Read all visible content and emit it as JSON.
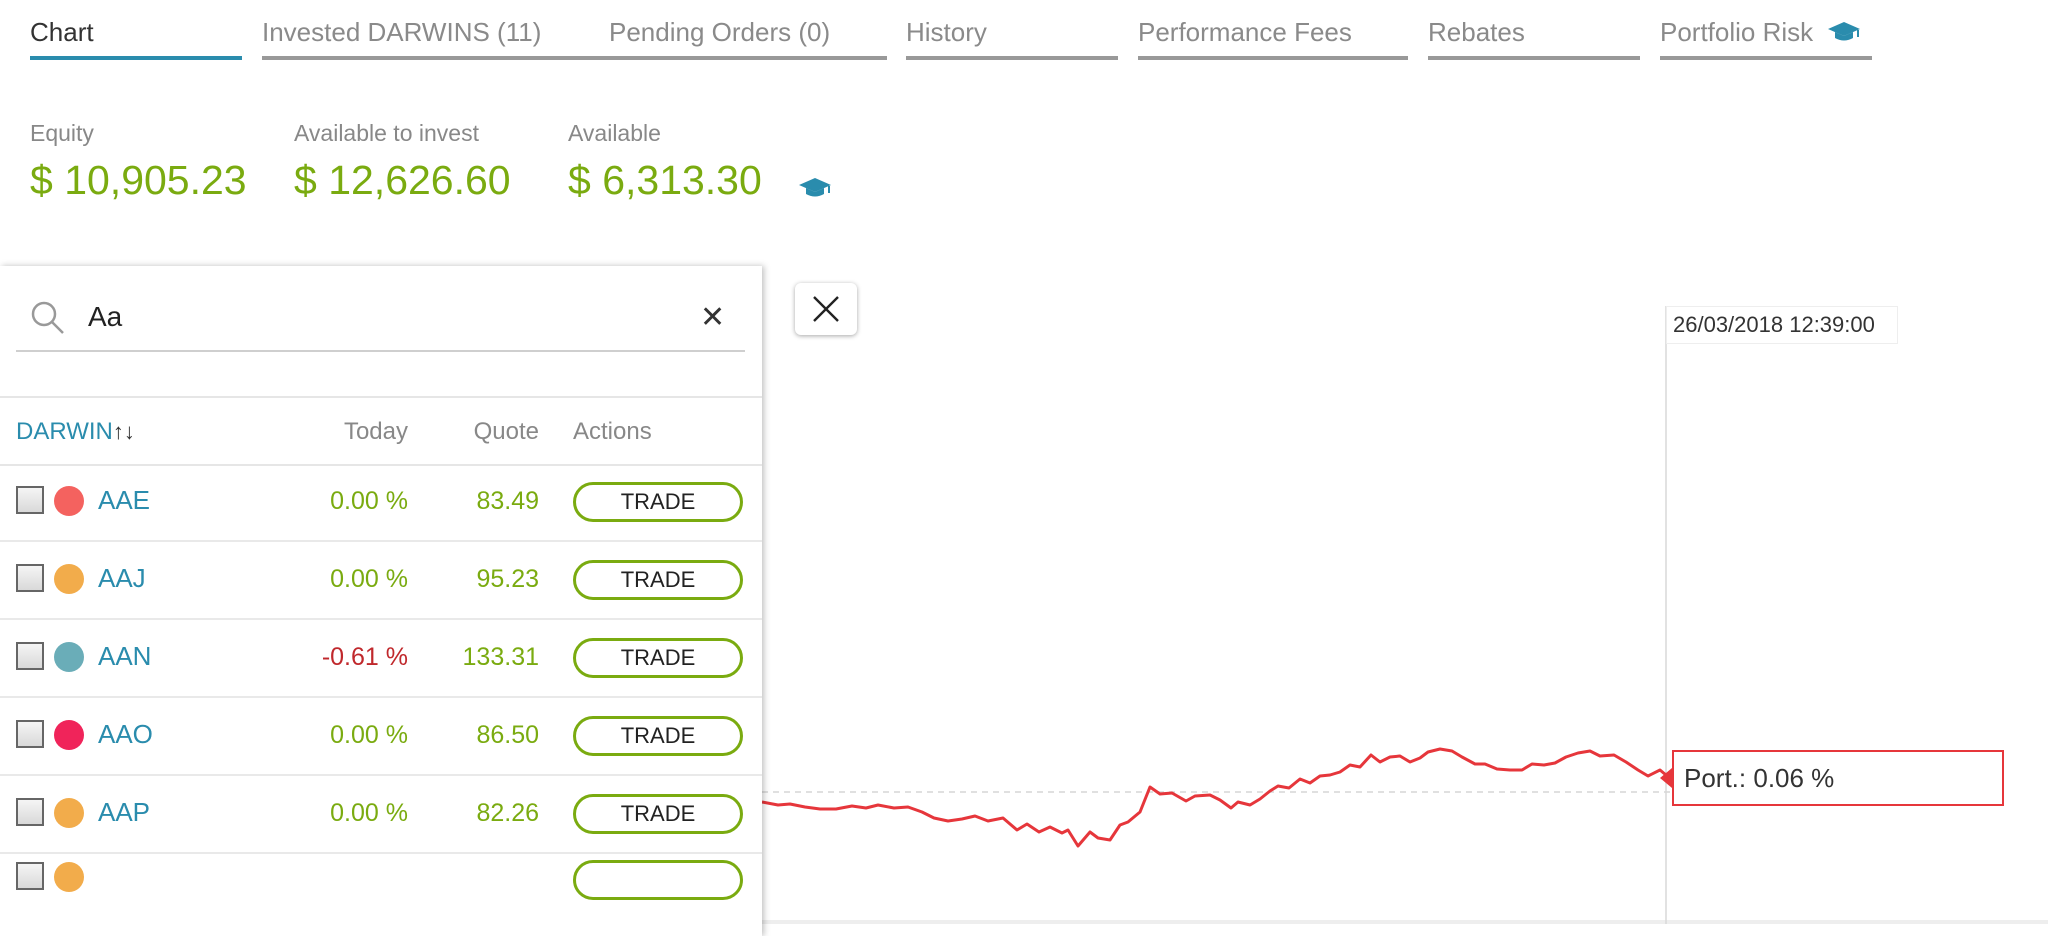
{
  "tabs": [
    {
      "label": "Chart"
    },
    {
      "label": "Invested DARWINS (11)"
    },
    {
      "label": "Pending Orders (0)"
    },
    {
      "label": "History"
    },
    {
      "label": "Performance Fees"
    },
    {
      "label": "Rebates"
    },
    {
      "label": "Portfolio Risk",
      "icon": "graduation-cap-icon"
    }
  ],
  "balances": {
    "equity": {
      "label": "Equity",
      "value": "$ 10,905.23"
    },
    "available_to_invest": {
      "label": "Available to invest",
      "value": "$ 12,626.60"
    },
    "available": {
      "label": "Available",
      "value": "$ 6,313.30"
    }
  },
  "search": {
    "value": "Aa",
    "clear_label": "✕"
  },
  "table": {
    "headers": {
      "darwin": "DARWIN",
      "sort_icon": "↑↓",
      "today": "Today",
      "quote": "Quote",
      "actions": "Actions"
    },
    "rows": [
      {
        "name": "AAE",
        "today": "0.00 %",
        "quote": "83.49",
        "action": "TRADE",
        "color": "#f4625f"
      },
      {
        "name": "AAJ",
        "today": "0.00 %",
        "quote": "95.23",
        "action": "TRADE",
        "color": "#f2ac4b"
      },
      {
        "name": "AAN",
        "today": "-0.61 %",
        "quote": "133.31",
        "action": "TRADE",
        "color": "#6aadb8"
      },
      {
        "name": "AAO",
        "today": "0.00 %",
        "quote": "86.50",
        "action": "TRADE",
        "color": "#f0245a"
      },
      {
        "name": "AAP",
        "today": "0.00 %",
        "quote": "82.26",
        "action": "TRADE",
        "color": "#f2ac4b"
      }
    ]
  },
  "chart": {
    "tooltip_date": "26/03/2018 12:39:00",
    "port_label": "Port.: 0.06 %",
    "line_color": "#e6363b"
  }
}
